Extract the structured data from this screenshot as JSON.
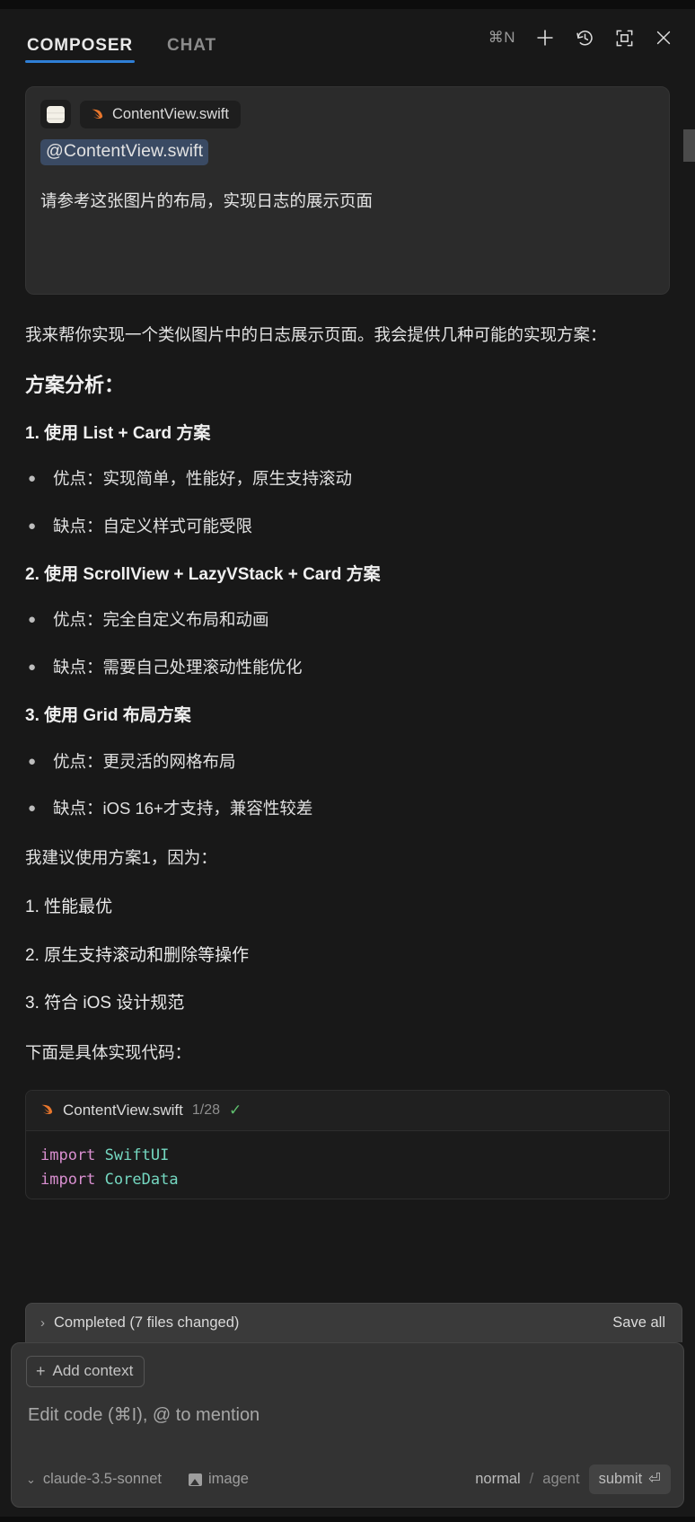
{
  "header": {
    "tabs": [
      {
        "label": "COMPOSER",
        "active": true
      },
      {
        "label": "CHAT",
        "active": false
      }
    ],
    "shortcut_hint": "⌘N",
    "icons": [
      "plus-icon",
      "history-icon",
      "expand-icon",
      "close-icon"
    ]
  },
  "user_message": {
    "attachment_thumb": "image-thumbnail",
    "file_chip": "ContentView.swift",
    "mention": "@ContentView.swift",
    "text": "请参考这张图片的布局，实现日志的展示页面"
  },
  "assistant": {
    "intro": "我来帮你实现一个类似图片中的日志展示页面。我会提供几种可能的实现方案：",
    "heading": "方案分析：",
    "options": [
      {
        "title": "1. 使用 List + Card 方案",
        "bullets": [
          "优点：实现简单，性能好，原生支持滚动",
          "缺点：自定义样式可能受限"
        ]
      },
      {
        "title": "2. 使用 ScrollView + LazyVStack + Card 方案",
        "bullets": [
          "优点：完全自定义布局和动画",
          "缺点：需要自己处理滚动性能优化"
        ]
      },
      {
        "title": "3. 使用 Grid 布局方案",
        "bullets": [
          "优点：更灵活的网格布局",
          "缺点：iOS 16+才支持，兼容性较差"
        ]
      }
    ],
    "recommend_intro": "我建议使用方案1，因为：",
    "reasons": [
      "1. 性能最优",
      "2. 原生支持滚动和删除等操作",
      "3. 符合 iOS 设计规范"
    ],
    "code_intro": "下面是具体实现代码：",
    "code_block": {
      "filename": "ContentView.swift",
      "count": "1/28",
      "check": "✓",
      "lines": [
        {
          "kw": "import",
          "ty": "SwiftUI"
        },
        {
          "kw": "import",
          "ty": "CoreData"
        }
      ]
    }
  },
  "completed_bar": {
    "chevron": "›",
    "label": "Completed (7 files changed)",
    "save_all": "Save all"
  },
  "composer": {
    "add_context": "Add context",
    "plus": "+",
    "placeholder": "Edit code (⌘I), @ to mention",
    "model": "claude-3.5-sonnet",
    "chevron_down": "⌄",
    "image_badge": "image",
    "mode_normal": "normal",
    "slash": "/",
    "mode_agent": "agent",
    "submit": "submit",
    "submit_glyph": "⏎"
  },
  "colors": {
    "accent": "#2f7fd6",
    "background": "#181818",
    "card": "#2b2b2b",
    "mention": "#3a4a63",
    "swift_orange": "#e8762c",
    "check_green": "#5fbf6e",
    "code_keyword": "#d98fd0",
    "code_type": "#74d7c0"
  }
}
